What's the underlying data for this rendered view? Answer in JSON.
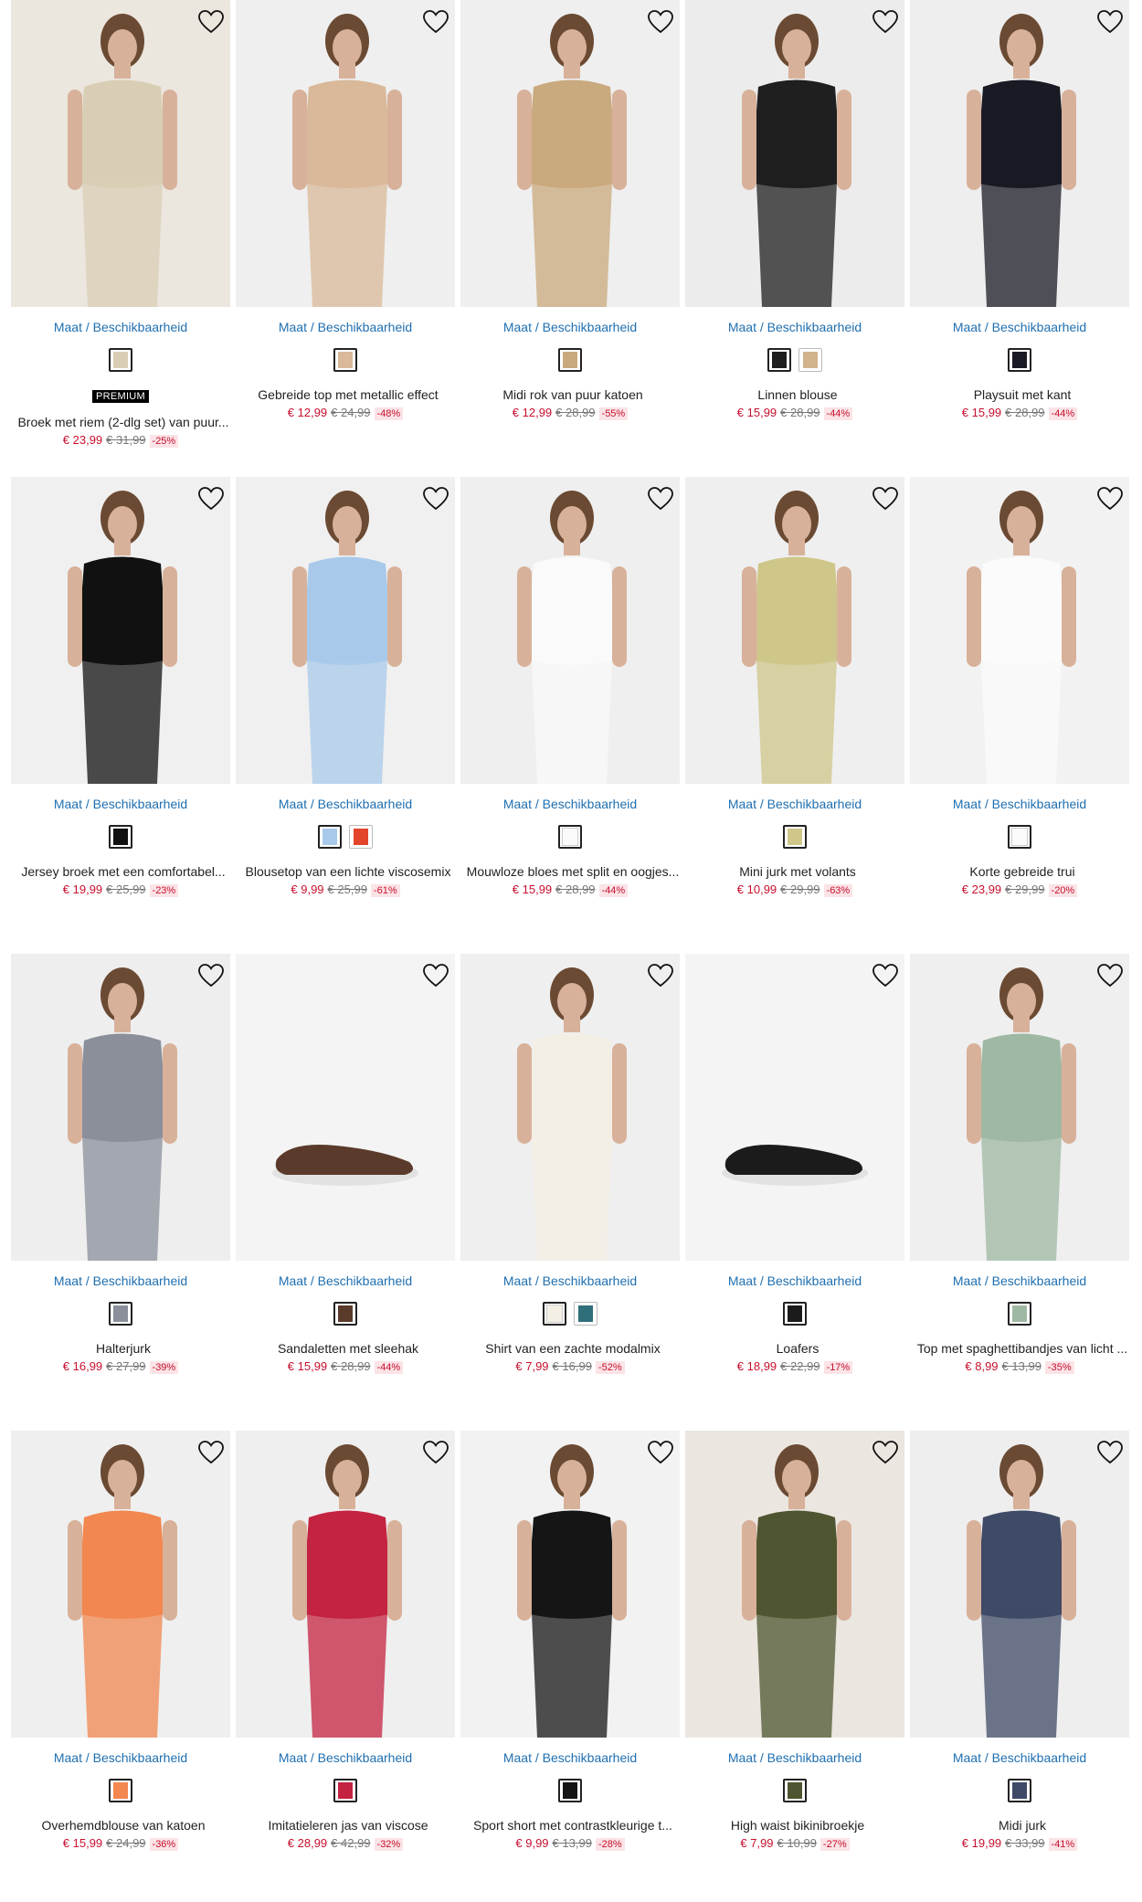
{
  "maat_label": "Maat / Beschikbaarheid",
  "colors": {
    "price": "#c8102e",
    "link": "#1f6fb0",
    "discount_bg": "#fbe3e6"
  },
  "products": [
    {
      "name": "Broek met riem (2-dlg set) van puur...",
      "badge": "PREMIUM",
      "price": "€ 23,99",
      "old_price": "€ 31,99",
      "discount": "-25%",
      "image_bg": "#ebe6de",
      "garment": "#d9ceb5",
      "swatches": [
        "#d9ceb5"
      ]
    },
    {
      "name": "Gebreide top met metallic effect",
      "price": "€ 12,99",
      "old_price": "€ 24,99",
      "discount": "-48%",
      "image_bg": "#efefef",
      "garment": "#d9b99a",
      "swatches": [
        "#d9b99a"
      ]
    },
    {
      "name": "Midi rok van puur katoen",
      "price": "€ 12,99",
      "old_price": "€ 28,99",
      "discount": "-55%",
      "image_bg": "#efefef",
      "garment": "#c9a97e",
      "swatches": [
        "#c9a97e"
      ]
    },
    {
      "name": "Linnen blouse",
      "price": "€ 15,99",
      "old_price": "€ 28,99",
      "discount": "-44%",
      "image_bg": "#ececec",
      "garment": "#1f1f1f",
      "swatches": [
        "#1f1f1f",
        "#d2b48c"
      ]
    },
    {
      "name": "Playsuit met kant",
      "price": "€ 15,99",
      "old_price": "€ 28,99",
      "discount": "-44%",
      "image_bg": "#eeeeee",
      "garment": "#1a1a24",
      "swatches": [
        "#1a1a24"
      ]
    },
    {
      "name": "Jersey broek met een comfortabel...",
      "price": "€ 19,99",
      "old_price": "€ 25,99",
      "discount": "-23%",
      "image_bg": "#f0f0f0",
      "garment": "#111111",
      "swatches": [
        "#111111"
      ]
    },
    {
      "name": "Blousetop van een lichte viscosemix",
      "price": "€ 9,99",
      "old_price": "€ 25,99",
      "discount": "-61%",
      "image_bg": "#f0f0f0",
      "garment": "#a9c9ea",
      "swatches": [
        "#a9c9ea",
        "#e2452b"
      ]
    },
    {
      "name": "Mouwloze bloes met split en oogjes...",
      "price": "€ 15,99",
      "old_price": "€ 28,99",
      "discount": "-44%",
      "image_bg": "#efefef",
      "garment": "#fafafa",
      "swatches": [
        "#fafafa"
      ]
    },
    {
      "name": "Mini jurk met volants",
      "price": "€ 10,99",
      "old_price": "€ 29,99",
      "discount": "-63%",
      "image_bg": "#efefef",
      "garment": "#cfc68a",
      "swatches": [
        "#cfc68a"
      ]
    },
    {
      "name": "Korte gebreide trui",
      "price": "€ 23,99",
      "old_price": "€ 29,99",
      "discount": "-20%",
      "image_bg": "#f2f2f2",
      "garment": "#fbfbfb",
      "swatches": [
        "#fbfbfb"
      ]
    },
    {
      "name": "Halterjurk",
      "price": "€ 16,99",
      "old_price": "€ 27,99",
      "discount": "-39%",
      "image_bg": "#eeeeee",
      "garment": "#8a8f9a",
      "swatches": [
        "#8a8f9a"
      ]
    },
    {
      "name": "Sandaletten met sleehak",
      "price": "€ 15,99",
      "old_price": "€ 28,99",
      "discount": "-44%",
      "image_bg": "#f4f4f4",
      "garment": "#5a3a2a",
      "swatches": [
        "#5a3a2a"
      ]
    },
    {
      "name": "Shirt van een zachte modalmix",
      "price": "€ 7,99",
      "old_price": "€ 16,99",
      "discount": "-52%",
      "image_bg": "#efefef",
      "garment": "#f4efe4",
      "swatches": [
        "#f4efe4",
        "#2f6f7a"
      ]
    },
    {
      "name": "Loafers",
      "price": "€ 18,99",
      "old_price": "€ 22,99",
      "discount": "-17%",
      "image_bg": "#f4f4f4",
      "garment": "#1b1b1b",
      "swatches": [
        "#1b1b1b"
      ]
    },
    {
      "name": "Top met spaghettibandjes van licht ...",
      "price": "€ 8,99",
      "old_price": "€ 13,99",
      "discount": "-35%",
      "image_bg": "#efefef",
      "garment": "#9fb8a3",
      "swatches": [
        "#9fb8a3"
      ]
    },
    {
      "name": "Overhemdblouse van katoen",
      "price": "€ 15,99",
      "old_price": "€ 24,99",
      "discount": "-36%",
      "image_bg": "#efefef",
      "garment": "#f2874f",
      "swatches": [
        "#f2874f"
      ]
    },
    {
      "name": "Imitatieleren jas van viscose",
      "price": "€ 28,99",
      "old_price": "€ 42,99",
      "discount": "-32%",
      "image_bg": "#efefef",
      "garment": "#c42341",
      "swatches": [
        "#c42341"
      ]
    },
    {
      "name": "Sport short met contrastkleurige t...",
      "price": "€ 9,99",
      "old_price": "€ 13,99",
      "discount": "-28%",
      "image_bg": "#f2f2f2",
      "garment": "#151515",
      "swatches": [
        "#151515"
      ]
    },
    {
      "name": "High waist bikinibroekje",
      "price": "€ 7,99",
      "old_price": "€ 10,99",
      "discount": "-27%",
      "image_bg": "#ebe6e0",
      "garment": "#4f5530",
      "swatches": [
        "#4f5530"
      ]
    },
    {
      "name": "Midi jurk",
      "price": "€ 19,99",
      "old_price": "€ 33,99",
      "discount": "-41%",
      "image_bg": "#eeeeee",
      "garment": "#3f4a66",
      "swatches": [
        "#3f4a66"
      ]
    }
  ]
}
